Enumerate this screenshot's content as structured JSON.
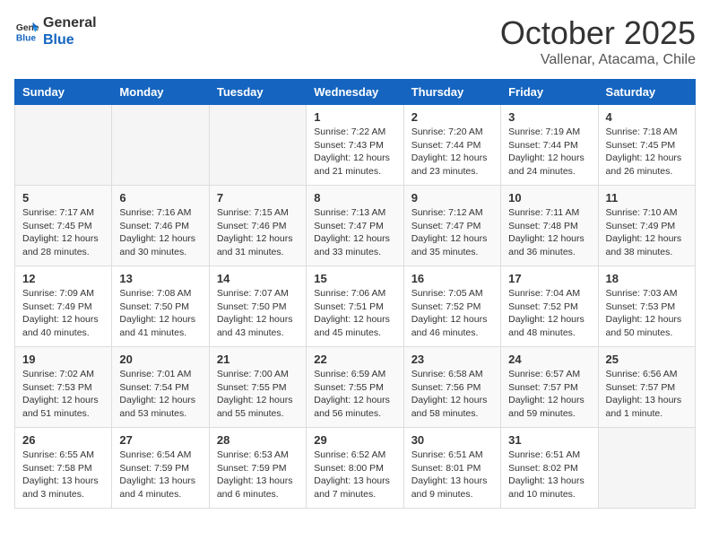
{
  "header": {
    "logo_line1": "General",
    "logo_line2": "Blue",
    "month": "October 2025",
    "location": "Vallenar, Atacama, Chile"
  },
  "days_of_week": [
    "Sunday",
    "Monday",
    "Tuesday",
    "Wednesday",
    "Thursday",
    "Friday",
    "Saturday"
  ],
  "weeks": [
    [
      {
        "day": "",
        "info": ""
      },
      {
        "day": "",
        "info": ""
      },
      {
        "day": "",
        "info": ""
      },
      {
        "day": "1",
        "info": "Sunrise: 7:22 AM\nSunset: 7:43 PM\nDaylight: 12 hours\nand 21 minutes."
      },
      {
        "day": "2",
        "info": "Sunrise: 7:20 AM\nSunset: 7:44 PM\nDaylight: 12 hours\nand 23 minutes."
      },
      {
        "day": "3",
        "info": "Sunrise: 7:19 AM\nSunset: 7:44 PM\nDaylight: 12 hours\nand 24 minutes."
      },
      {
        "day": "4",
        "info": "Sunrise: 7:18 AM\nSunset: 7:45 PM\nDaylight: 12 hours\nand 26 minutes."
      }
    ],
    [
      {
        "day": "5",
        "info": "Sunrise: 7:17 AM\nSunset: 7:45 PM\nDaylight: 12 hours\nand 28 minutes."
      },
      {
        "day": "6",
        "info": "Sunrise: 7:16 AM\nSunset: 7:46 PM\nDaylight: 12 hours\nand 30 minutes."
      },
      {
        "day": "7",
        "info": "Sunrise: 7:15 AM\nSunset: 7:46 PM\nDaylight: 12 hours\nand 31 minutes."
      },
      {
        "day": "8",
        "info": "Sunrise: 7:13 AM\nSunset: 7:47 PM\nDaylight: 12 hours\nand 33 minutes."
      },
      {
        "day": "9",
        "info": "Sunrise: 7:12 AM\nSunset: 7:47 PM\nDaylight: 12 hours\nand 35 minutes."
      },
      {
        "day": "10",
        "info": "Sunrise: 7:11 AM\nSunset: 7:48 PM\nDaylight: 12 hours\nand 36 minutes."
      },
      {
        "day": "11",
        "info": "Sunrise: 7:10 AM\nSunset: 7:49 PM\nDaylight: 12 hours\nand 38 minutes."
      }
    ],
    [
      {
        "day": "12",
        "info": "Sunrise: 7:09 AM\nSunset: 7:49 PM\nDaylight: 12 hours\nand 40 minutes."
      },
      {
        "day": "13",
        "info": "Sunrise: 7:08 AM\nSunset: 7:50 PM\nDaylight: 12 hours\nand 41 minutes."
      },
      {
        "day": "14",
        "info": "Sunrise: 7:07 AM\nSunset: 7:50 PM\nDaylight: 12 hours\nand 43 minutes."
      },
      {
        "day": "15",
        "info": "Sunrise: 7:06 AM\nSunset: 7:51 PM\nDaylight: 12 hours\nand 45 minutes."
      },
      {
        "day": "16",
        "info": "Sunrise: 7:05 AM\nSunset: 7:52 PM\nDaylight: 12 hours\nand 46 minutes."
      },
      {
        "day": "17",
        "info": "Sunrise: 7:04 AM\nSunset: 7:52 PM\nDaylight: 12 hours\nand 48 minutes."
      },
      {
        "day": "18",
        "info": "Sunrise: 7:03 AM\nSunset: 7:53 PM\nDaylight: 12 hours\nand 50 minutes."
      }
    ],
    [
      {
        "day": "19",
        "info": "Sunrise: 7:02 AM\nSunset: 7:53 PM\nDaylight: 12 hours\nand 51 minutes."
      },
      {
        "day": "20",
        "info": "Sunrise: 7:01 AM\nSunset: 7:54 PM\nDaylight: 12 hours\nand 53 minutes."
      },
      {
        "day": "21",
        "info": "Sunrise: 7:00 AM\nSunset: 7:55 PM\nDaylight: 12 hours\nand 55 minutes."
      },
      {
        "day": "22",
        "info": "Sunrise: 6:59 AM\nSunset: 7:55 PM\nDaylight: 12 hours\nand 56 minutes."
      },
      {
        "day": "23",
        "info": "Sunrise: 6:58 AM\nSunset: 7:56 PM\nDaylight: 12 hours\nand 58 minutes."
      },
      {
        "day": "24",
        "info": "Sunrise: 6:57 AM\nSunset: 7:57 PM\nDaylight: 12 hours\nand 59 minutes."
      },
      {
        "day": "25",
        "info": "Sunrise: 6:56 AM\nSunset: 7:57 PM\nDaylight: 13 hours\nand 1 minute."
      }
    ],
    [
      {
        "day": "26",
        "info": "Sunrise: 6:55 AM\nSunset: 7:58 PM\nDaylight: 13 hours\nand 3 minutes."
      },
      {
        "day": "27",
        "info": "Sunrise: 6:54 AM\nSunset: 7:59 PM\nDaylight: 13 hours\nand 4 minutes."
      },
      {
        "day": "28",
        "info": "Sunrise: 6:53 AM\nSunset: 7:59 PM\nDaylight: 13 hours\nand 6 minutes."
      },
      {
        "day": "29",
        "info": "Sunrise: 6:52 AM\nSunset: 8:00 PM\nDaylight: 13 hours\nand 7 minutes."
      },
      {
        "day": "30",
        "info": "Sunrise: 6:51 AM\nSunset: 8:01 PM\nDaylight: 13 hours\nand 9 minutes."
      },
      {
        "day": "31",
        "info": "Sunrise: 6:51 AM\nSunset: 8:02 PM\nDaylight: 13 hours\nand 10 minutes."
      },
      {
        "day": "",
        "info": ""
      }
    ]
  ]
}
